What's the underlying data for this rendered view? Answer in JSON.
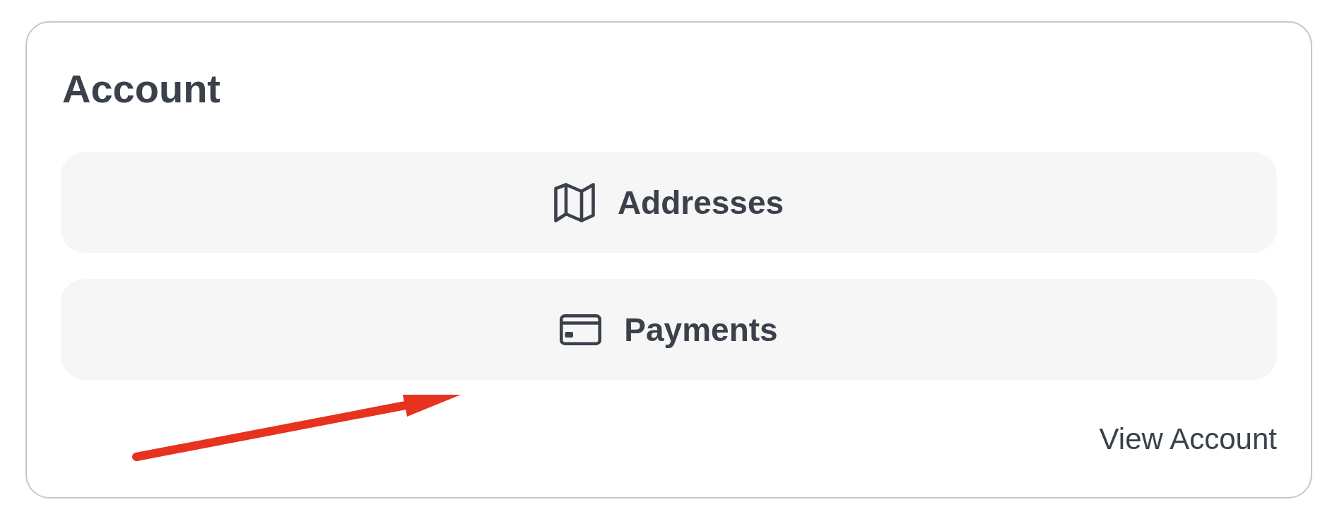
{
  "card": {
    "title": "Account",
    "buttons": [
      {
        "label": "Addresses"
      },
      {
        "label": "Payments"
      }
    ],
    "link": "View Account"
  },
  "annotations": [
    {
      "kind": "arrow"
    }
  ]
}
